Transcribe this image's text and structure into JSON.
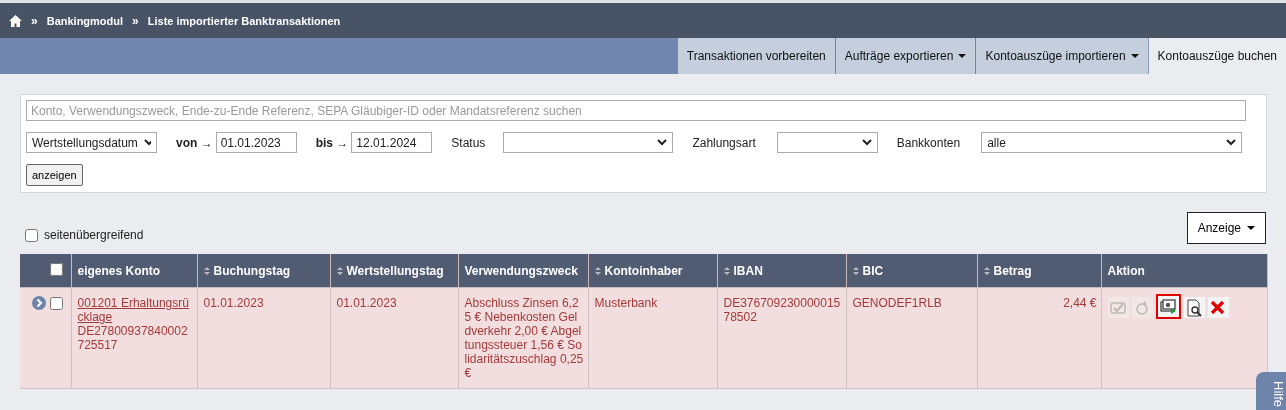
{
  "breadcrumb": [
    {
      "kind": "home"
    },
    {
      "kind": "link",
      "separator": "»",
      "label": "Bankingmodul"
    },
    {
      "kind": "current",
      "separator": "»",
      "label": "Liste importierter Banktransaktionen"
    }
  ],
  "tabs": [
    {
      "label": "Transaktionen vorbereiten",
      "dropdown": false,
      "selected": false
    },
    {
      "label": "Aufträge exportieren",
      "dropdown": true,
      "selected": false
    },
    {
      "label": "Kontoauszüge importieren",
      "dropdown": true,
      "selected": false
    },
    {
      "label": "Kontoauszüge buchen",
      "dropdown": false,
      "selected": true
    }
  ],
  "filter": {
    "search": {
      "placeholder": "Konto, Verwendungszweck, Ende-zu-Ende Referenz, SEPA Gläubiger-ID oder Mandatsreferenz suchen"
    },
    "date_field": {
      "value": "Wertstellungsdatum"
    },
    "from": {
      "label": "von",
      "arrow": "→",
      "value": "01.01.2023"
    },
    "to": {
      "label": "bis",
      "arrow": "→",
      "value": "12.01.2024"
    },
    "status": {
      "label": "Status"
    },
    "payment_type": {
      "label": "Zahlungsart"
    },
    "bank_accounts": {
      "label": "Bankkonten",
      "value": "alle"
    },
    "submit": "anzeigen"
  },
  "across_pages": {
    "label": "seitenübergreifend",
    "checked": false
  },
  "display_button": {
    "label": "Anzeige"
  },
  "table": {
    "select_all_checked": false,
    "columns": [
      {
        "label": "eigenes Konto",
        "sortable": false
      },
      {
        "label": "Buchungstag",
        "sortable": true
      },
      {
        "label": "Wertstellungstag",
        "sortable": true
      },
      {
        "label": "Verwendungszweck",
        "sortable": false
      },
      {
        "label": "Kontoinhaber",
        "sortable": true
      },
      {
        "label": "IBAN",
        "sortable": true
      },
      {
        "label": "BIC",
        "sortable": true
      },
      {
        "label": "Betrag",
        "sortable": true
      },
      {
        "label": "Aktion",
        "sortable": false
      }
    ],
    "rows": [
      {
        "checked": false,
        "account_link": "001201 Erhaltungsrücklage",
        "account_iban": "DE27800937840002725517",
        "booking_date": "01.01.2023",
        "value_date": "01.01.2023",
        "purpose": "Abschluss Zinsen 6,25 € Nebenkosten Geldverkehr 2,00 € Abgeltungssteuer 1,56 € Solidaritätszuschlag 0,25 €",
        "holder": "Musterbank",
        "iban": "DE37670923000001578502",
        "bic": "GENODEF1RLB",
        "amount": "2,44 €",
        "actions": [
          {
            "kind": "confirm",
            "disabled": true,
            "highlighted": false
          },
          {
            "kind": "revert",
            "disabled": true,
            "highlighted": false
          },
          {
            "kind": "book",
            "disabled": false,
            "highlighted": true
          },
          {
            "kind": "preview",
            "disabled": false,
            "highlighted": false
          },
          {
            "kind": "delete",
            "disabled": false,
            "highlighted": false
          }
        ]
      }
    ]
  },
  "help_tab": {
    "label": "Hilfe"
  }
}
